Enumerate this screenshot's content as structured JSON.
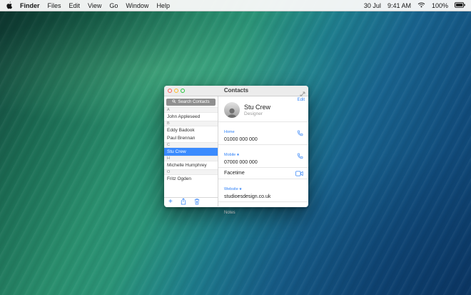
{
  "menu_bar": {
    "items": [
      "Finder",
      "Files",
      "Edit",
      "View",
      "Go",
      "Window",
      "Help"
    ],
    "status": {
      "date": "30 Jul",
      "time": "9:41 AM",
      "battery": "100%"
    }
  },
  "window": {
    "title": "Contacts",
    "sidebar": {
      "search_placeholder": "Search Contacts",
      "rows": [
        {
          "type": "letter",
          "text": "A"
        },
        {
          "type": "contact",
          "text": "John Appleseed"
        },
        {
          "type": "letter",
          "text": "B"
        },
        {
          "type": "contact",
          "text": "Eddy Badook"
        },
        {
          "type": "contact",
          "text": "Paul Brennan"
        },
        {
          "type": "letter",
          "text": "C"
        },
        {
          "type": "contact",
          "text": "Stu Crew",
          "selected": true
        },
        {
          "type": "letter",
          "text": "H"
        },
        {
          "type": "contact",
          "text": "Michelle Humphrey"
        },
        {
          "type": "letter",
          "text": "O"
        },
        {
          "type": "contact",
          "text": "Fritz Ogden"
        }
      ]
    },
    "detail": {
      "edit_label": "Edit",
      "name": "Stu Crew",
      "role": "Designer",
      "fields": [
        {
          "label": "Home",
          "value": "01000 000 000"
        },
        {
          "label": "Mobile",
          "value": "07000 000 000",
          "starred": true
        },
        {
          "value": "Facetime"
        },
        {
          "label": "Website",
          "value": "studioesdesign.co.uk",
          "starred": true
        },
        {
          "label": "Notes"
        }
      ]
    }
  },
  "icons": {
    "star": "★",
    "plus": "+"
  },
  "colors": {
    "accent": "#2f81f7",
    "selection": "#3b8bfe",
    "menu_bar_bg": "#f8f8f8"
  }
}
